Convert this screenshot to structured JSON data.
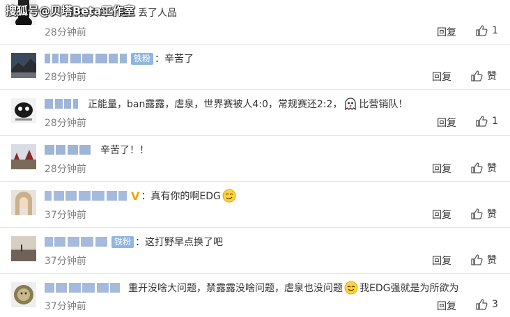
{
  "watermark": "搜狐号@贝塔Beta工作室",
  "colors": {
    "badge": "#8fb5e0",
    "vip": "#f5a400",
    "time": "#808080"
  },
  "comments": [
    {
      "username": "",
      "badge": "",
      "text": "露露真的牛逼，丢了人品",
      "time": "28分钟前",
      "reply": "回复",
      "likes": "1"
    },
    {
      "username": "",
      "badge": "铁粉",
      "text": "：辛苦了",
      "time": "28分钟前",
      "reply": "回复",
      "likes": "赞"
    },
    {
      "username": "",
      "badge": "",
      "text": "正能量，ban露露，虐泉，世界赛被人4:0，常规赛还2:2，",
      "text_after": "比营销队！",
      "time": "28分钟前",
      "reply": "回复",
      "likes": "1"
    },
    {
      "username": "",
      "badge": "",
      "text": "辛苦了！！",
      "time": "28分钟前",
      "reply": "回复",
      "likes": "赞"
    },
    {
      "username": "",
      "badge": "",
      "text": "：真有你的啊EDG",
      "time": "37分钟前",
      "reply": "回复",
      "likes": "赞"
    },
    {
      "username": "",
      "badge": "铁粉",
      "text": "：这打野早点换了吧",
      "time": "37分钟前",
      "reply": "回复",
      "likes": "赞"
    },
    {
      "username": "",
      "badge": "",
      "text": "重开没啥大问题，禁露露没啥问题，虐泉也没问题",
      "text_after": "我EDG强就是为所欲为",
      "time": "37分钟前",
      "reply": "回复",
      "likes": "3"
    }
  ]
}
